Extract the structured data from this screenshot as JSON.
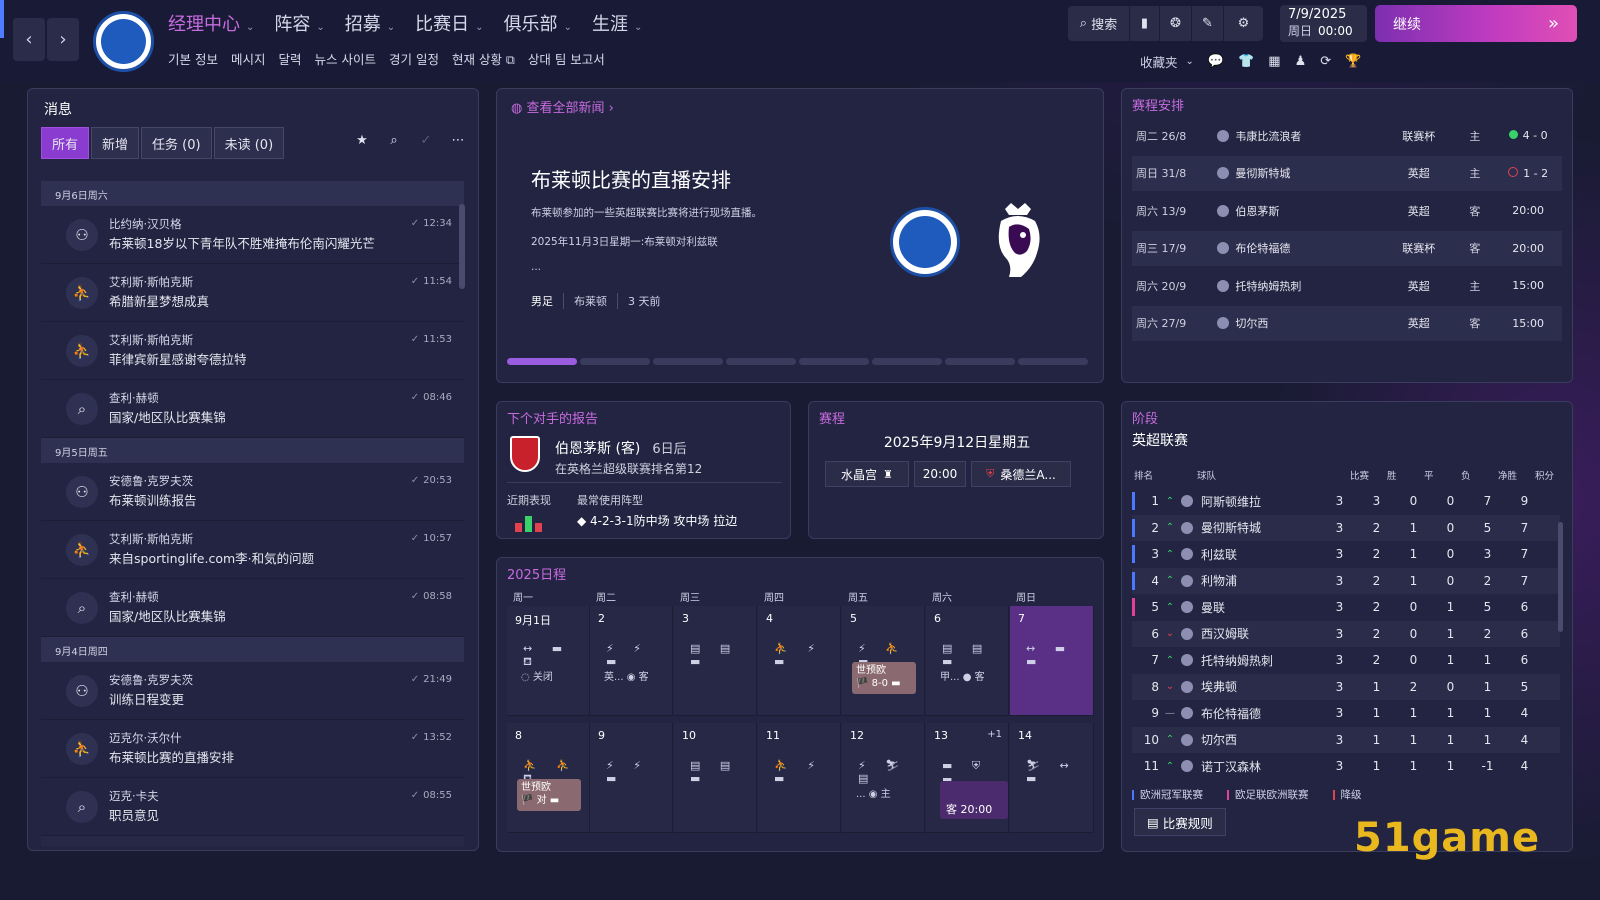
{
  "topbar": {
    "menu": [
      {
        "label": "经理中心",
        "active": true
      },
      {
        "label": "阵容"
      },
      {
        "label": "招募"
      },
      {
        "label": "比赛日"
      },
      {
        "label": "俱乐部"
      },
      {
        "label": "生涯"
      }
    ],
    "submenu": [
      "기본 정보",
      "메시지",
      "달력",
      "뉴스 사이트",
      "경기 일정",
      "현재 상황 ⧉",
      "상대 팀 보고서"
    ],
    "search_label": "搜索",
    "date": "7/9/2025",
    "weekday": "周日",
    "time": "00:00",
    "continue_label": "继续",
    "favorites_label": "收藏夹"
  },
  "messages": {
    "title": "消息",
    "filters": [
      "所有",
      "新增",
      "任务 (0)",
      "未读 (0)"
    ],
    "groups": [
      {
        "day": "9月6日周六",
        "items": [
          {
            "sender": "比约纳·汉贝格",
            "subject": "布莱顿18岁以下青年队不胜难掩布伦南闪耀光芒",
            "time": "12:34",
            "icon": "people-icon"
          },
          {
            "sender": "艾利斯·斯帕克斯",
            "subject": "希腊新星梦想成真",
            "time": "11:54",
            "icon": "scout-icon"
          },
          {
            "sender": "艾利斯·斯帕克斯",
            "subject": "菲律宾新星感谢夸德拉特",
            "time": "11:53",
            "icon": "scout-icon"
          },
          {
            "sender": "查利·赫顿",
            "subject": "国家/地区队比赛集锦",
            "time": "08:46",
            "icon": "search-icon"
          }
        ]
      },
      {
        "day": "9月5日周五",
        "items": [
          {
            "sender": "安德鲁·克罗夫茨",
            "subject": "布莱顿训练报告",
            "time": "20:53",
            "icon": "people-icon"
          },
          {
            "sender": "艾利斯·斯帕克斯",
            "subject": "来自sportinglife.com李·和気的问题",
            "time": "10:57",
            "icon": "scout-icon"
          },
          {
            "sender": "查利·赫顿",
            "subject": "国家/地区队比赛集锦",
            "time": "08:58",
            "icon": "search-icon"
          }
        ]
      },
      {
        "day": "9月4日周四",
        "items": [
          {
            "sender": "安德鲁·克罗夫茨",
            "subject": "训练日程变更",
            "time": "21:49",
            "icon": "people-icon"
          },
          {
            "sender": "迈克尔·沃尔什",
            "subject": "布莱顿比赛的直播安排",
            "time": "13:52",
            "icon": "scout-icon"
          },
          {
            "sender": "迈克·卡夫",
            "subject": "职员意见",
            "time": "08:55",
            "icon": "search-icon"
          }
        ]
      }
    ]
  },
  "news": {
    "link": "查看全部新闻",
    "headline": "布莱顿比赛的直播安排",
    "p1": "布莱顿参加的一些英超联赛比赛将进行现场直播。",
    "p2": "2025年11月3日星期一:布莱顿对利兹联",
    "p3": "...",
    "tags": [
      "男足",
      "布莱顿",
      "3 天前"
    ]
  },
  "fixtures": {
    "title": "赛程安排",
    "rows": [
      {
        "date": "周二 26/8",
        "opp": "韦康比流浪者",
        "comp": "联赛杯",
        "venue": "主",
        "result": "4 - 0",
        "rtype": "win"
      },
      {
        "date": "周日 31/8",
        "opp": "曼彻斯特城",
        "comp": "英超",
        "venue": "主",
        "result": "1 - 2",
        "rtype": "loss"
      },
      {
        "date": "周六 13/9",
        "opp": "伯恩茅斯",
        "comp": "英超",
        "venue": "客",
        "result": "20:00",
        "rtype": "time"
      },
      {
        "date": "周三 17/9",
        "opp": "布伦特福德",
        "comp": "联赛杯",
        "venue": "客",
        "result": "20:00",
        "rtype": "time"
      },
      {
        "date": "周六 20/9",
        "opp": "托特纳姆热刺",
        "comp": "英超",
        "venue": "主",
        "result": "15:00",
        "rtype": "time"
      },
      {
        "date": "周六 27/9",
        "opp": "切尔西",
        "comp": "英超",
        "venue": "客",
        "result": "15:00",
        "rtype": "time"
      }
    ]
  },
  "opponent": {
    "title": "下个对手的报告",
    "name": "伯恩茅斯 (客)",
    "when": "6日后",
    "rank": "在英格兰超级联赛排名第12",
    "form_label": "近期表现",
    "formation_label": "最常使用阵型",
    "formation": "◆ 4-2-3-1防中场 攻中场 拉边",
    "form": [
      {
        "res": "L",
        "level": 0.5
      },
      {
        "res": "W",
        "level": 0.9
      },
      {
        "res": "L",
        "level": 0.5
      }
    ]
  },
  "match": {
    "title": "赛程",
    "date": "2025年9月12日星期五",
    "home": "水晶宫",
    "time": "20:00",
    "away": "桑德兰A..."
  },
  "calendar": {
    "title": "2025日程",
    "weekdays": [
      "周一",
      "周二",
      "周三",
      "周四",
      "周五",
      "周六",
      "周日"
    ],
    "week1": [
      {
        "d": "9月1日",
        "ic": "↔ ▬ ⛾",
        "ex": "◌ 关闭"
      },
      {
        "d": "2",
        "ic": "⚡ ⚡ ▬",
        "ex": "英... ◉ 客"
      },
      {
        "d": "3",
        "ic": "▤ ▤ ▬",
        "ex": ""
      },
      {
        "d": "4",
        "ic": "⛹ ⚡ ▬",
        "ex": ""
      },
      {
        "d": "5",
        "ic": "⚡ ⛹ ▬",
        "chip": "世预欧",
        "chip2": "🏴 8-0 ▬"
      },
      {
        "d": "6",
        "ic": "▤ ▤ ▬",
        "ex": "甲... ● 客"
      },
      {
        "d": "7",
        "ic": "↔ ▬ ▬",
        "today": true
      }
    ],
    "week2": [
      {
        "d": "8",
        "ic": "⛹ ⛹ ⛾",
        "chip": "世预欧",
        "chip2": "🏴 对 ▬"
      },
      {
        "d": "9",
        "ic": "⚡ ⚡ ▬",
        "ex": ""
      },
      {
        "d": "10",
        "ic": "▤ ▤ ▬",
        "ex": ""
      },
      {
        "d": "11",
        "ic": "⛹ ⚡ ▬",
        "ex": ""
      },
      {
        "d": "12",
        "ic": "⚡ ⛷ ▤",
        "ex": "... ◉ 主"
      },
      {
        "d": "13",
        "extra": "+1",
        "ic": "▬ ⛨ ▬",
        "m2": "客 20:00"
      },
      {
        "d": "14",
        "ic": "⛷ ↔ ▬",
        "ex": ""
      }
    ]
  },
  "league": {
    "title": "阶段",
    "name": "英超联赛",
    "headers": [
      "排名",
      "球队",
      "比赛",
      "胜",
      "平",
      "负",
      "净胜",
      "积分"
    ],
    "rows": [
      {
        "r": "1",
        "t": "阿斯顿维拉",
        "p": "3",
        "w": "3",
        "d": "0",
        "l": "0",
        "gd": "7",
        "pts": "9",
        "trend": "up",
        "bar": "#4a78ff"
      },
      {
        "r": "2",
        "t": "曼彻斯特城",
        "p": "3",
        "w": "2",
        "d": "1",
        "l": "0",
        "gd": "5",
        "pts": "7",
        "trend": "up",
        "bar": "#4a78ff"
      },
      {
        "r": "3",
        "t": "利兹联",
        "p": "3",
        "w": "2",
        "d": "1",
        "l": "0",
        "gd": "3",
        "pts": "7",
        "trend": "up",
        "bar": "#4a78ff"
      },
      {
        "r": "4",
        "t": "利物浦",
        "p": "3",
        "w": "2",
        "d": "1",
        "l": "0",
        "gd": "2",
        "pts": "7",
        "trend": "up",
        "bar": "#4a78ff"
      },
      {
        "r": "5",
        "t": "曼联",
        "p": "3",
        "w": "2",
        "d": "0",
        "l": "1",
        "gd": "5",
        "pts": "6",
        "trend": "up",
        "bar": "#e0429a"
      },
      {
        "r": "6",
        "t": "西汉姆联",
        "p": "3",
        "w": "2",
        "d": "0",
        "l": "1",
        "gd": "2",
        "pts": "6",
        "trend": "down",
        "bar": ""
      },
      {
        "r": "7",
        "t": "托特纳姆热刺",
        "p": "3",
        "w": "2",
        "d": "0",
        "l": "1",
        "gd": "1",
        "pts": "6",
        "trend": "up",
        "bar": ""
      },
      {
        "r": "8",
        "t": "埃弗顿",
        "p": "3",
        "w": "1",
        "d": "2",
        "l": "0",
        "gd": "1",
        "pts": "5",
        "trend": "down",
        "bar": ""
      },
      {
        "r": "9",
        "t": "布伦特福德",
        "p": "3",
        "w": "1",
        "d": "1",
        "l": "1",
        "gd": "1",
        "pts": "4",
        "trend": "same",
        "bar": ""
      },
      {
        "r": "10",
        "t": "切尔西",
        "p": "3",
        "w": "1",
        "d": "1",
        "l": "1",
        "gd": "1",
        "pts": "4",
        "trend": "up",
        "bar": ""
      },
      {
        "r": "11",
        "t": "诺丁汉森林",
        "p": "3",
        "w": "1",
        "d": "1",
        "l": "1",
        "gd": "-1",
        "pts": "4",
        "trend": "up",
        "bar": ""
      }
    ],
    "legend": [
      "欧洲冠军联赛",
      "欧足联欧洲联赛",
      "降级"
    ],
    "rules": "比赛规则"
  },
  "watermark": "51game",
  "colors": {
    "accent": "#c86be0",
    "win": "#3bd16a",
    "loss": "#e0424f",
    "primary": "#8a3bd0"
  }
}
